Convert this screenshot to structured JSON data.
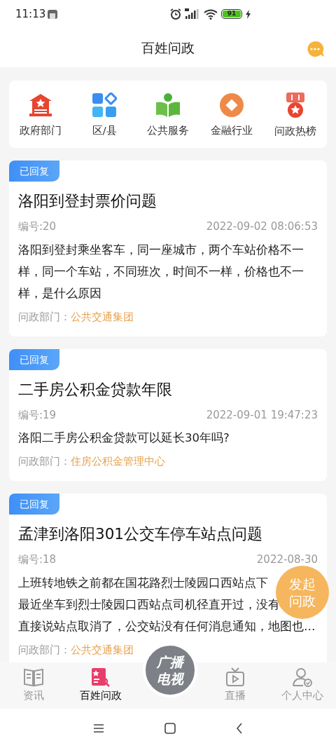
{
  "status_bar": {
    "time": "11:13",
    "battery": "91"
  },
  "header": {
    "title": "百姓问政"
  },
  "categories": [
    {
      "label": "政府部门"
    },
    {
      "label": "区/县"
    },
    {
      "label": "公共服务"
    },
    {
      "label": "金融行业"
    },
    {
      "label": "问政热榜"
    }
  ],
  "posts": [
    {
      "badge": "已回复",
      "title": "洛阳到登封票价问题",
      "number": "编号:20",
      "date": "2022-09-02 08:06:53",
      "body_lines": [
        "洛阳到登封乘坐客车，同一座城市，两个车站价格不一",
        "样，同一个车站，不同班次，时间不一样，价格也不一",
        "样，是什么原因"
      ],
      "dept_label": "问政部门：",
      "dept": "公共交通集团"
    },
    {
      "badge": "已回复",
      "title": "二手房公积金贷款年限",
      "number": "编号:19",
      "date": "2022-09-01 19:47:23",
      "body_lines": [
        "洛阳二手房公积金贷款可以延长30年吗?"
      ],
      "dept_label": "问政部门：",
      "dept": "住房公积金管理中心"
    },
    {
      "badge": "已回复",
      "title": "孟津到洛阳301公交车停车站点问题",
      "number": "编号:18",
      "date": "2022-08-30",
      "body_lines": [
        "上班转地铁之前都在国花路烈士陵园口西站点下",
        "最近坐车到烈士陵园口西站点司机径直开过，没有",
        "直接说站点取消了，公交站没有任何消息通知，地图也…"
      ],
      "dept_label": "问政部门：",
      "dept": "公共交通集团"
    }
  ],
  "fab": {
    "lines": [
      "发起",
      "问政"
    ]
  },
  "center_button": {
    "lines": [
      "广播",
      "电视"
    ]
  },
  "nav": [
    {
      "label": "资讯",
      "selected": false
    },
    {
      "label": "百姓问政",
      "selected": true
    },
    {
      "label": "直播",
      "selected": false
    },
    {
      "label": "个人中心",
      "selected": false
    }
  ]
}
